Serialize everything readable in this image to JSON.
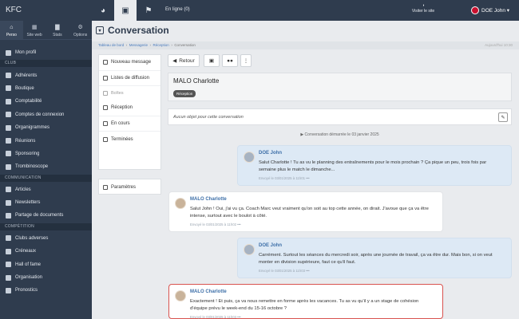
{
  "topbar": {
    "brand": "KFC",
    "online": "En ligne (0)",
    "visit": "Visiter le site",
    "user": "DOE John ▾"
  },
  "sidebar": {
    "tabs": [
      {
        "label": "Perso",
        "glyph": "⌂"
      },
      {
        "label": "Site web",
        "glyph": "▦"
      },
      {
        "label": "Stats",
        "glyph": "▇"
      },
      {
        "label": "Options",
        "glyph": "⚙"
      }
    ],
    "profile": "Mon profil",
    "club_header": "CLUB",
    "club": [
      "Adhérents",
      "Boutique",
      "Comptabilité",
      "Comptes de connexion",
      "Organigrammes",
      "Réunions",
      "Sponsoring",
      "Trombinoscope"
    ],
    "comm_header": "COMMUNICATION",
    "comm": [
      "Articles",
      "Newsletters",
      "Partage de documents"
    ],
    "comp_header": "COMPÉTITION",
    "comp": [
      "Clubs adverses",
      "Créneaux",
      "Hall of fame",
      "Organisation",
      "Pronostics"
    ]
  },
  "page": {
    "title": "Conversation"
  },
  "breadcrumb": {
    "items": [
      "Tableau de bord",
      "Messagerie",
      "Réception",
      "Conversation"
    ],
    "right": "Aujourd'hui 10:30"
  },
  "menu": {
    "new": "Nouveau message",
    "lists": "Listes de diffusion",
    "boxes": "Boîtes",
    "inbox": "Réception",
    "pending": "En cours",
    "done": "Terminées",
    "settings": "Paramètres"
  },
  "toolbar": {
    "back": "Retour"
  },
  "conversation": {
    "name": "MALO Charlotte",
    "badge": "Réception",
    "subject": "Aucun objet pour cette conversation",
    "started": "Conversation démarrée le 03 janvier 2025"
  },
  "messages": [
    {
      "author": "DOE John",
      "text": "Salut Charlotte ! Tu as vu le planning des entraînements pour le mois prochain ? Ça pique un peu, trois fois par semaine plus le match le dimanche...",
      "meta": "Envoyé le 03/01/2025 à 11h01 •••"
    },
    {
      "author": "MALO Charlotte",
      "text": "Salut John ! Oui, j'ai vu ça. Coach Marc veut vraiment qu'on soit au top cette année, on dirait. J'avoue que ça va être intense, surtout avec le boulot à côté.",
      "meta": "Envoyé le 03/01/2025 à 11h02 •••"
    },
    {
      "author": "DOE John",
      "text": "Carrément. Surtout les séances du mercredi soir, après une journée de travail, ça va être dur. Mais bon, si on veut monter en division supérieure, faut ce qu'il faut.",
      "meta": "Envoyé le 03/01/2025 à 11h03 •••"
    },
    {
      "author": "MALO Charlotte",
      "text": "Exactement ! Et puis, ça va nous remettre en forme après les vacances. Tu as vu qu'il y a un stage de cohésion d'équipe prévu le week-end du 15-16 octobre ?",
      "meta": "Envoyé le 03/01/2025 à 11h03 •••"
    }
  ]
}
